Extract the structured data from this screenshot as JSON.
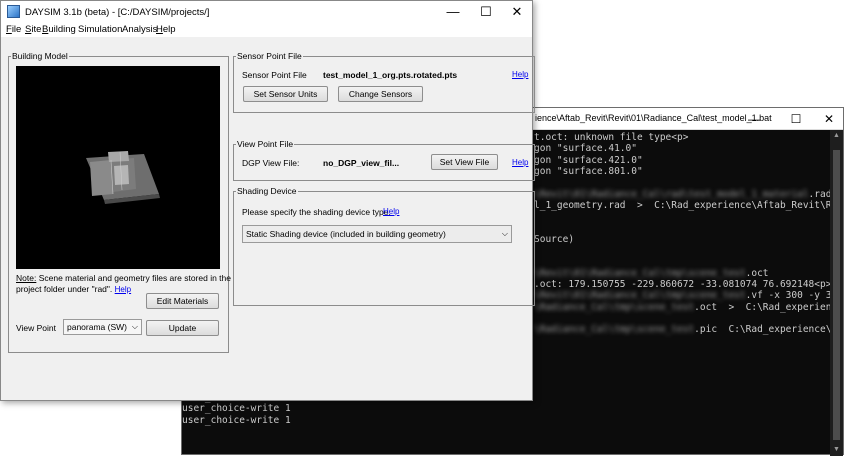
{
  "console": {
    "title": "ience\\Aftab_Revit\\Revit\\01\\Radiance_Cal\\test_model_1.bat",
    "controls": {
      "minimize": "—",
      "maximize": "☐",
      "close": "✕"
    },
    "lines": [
      {
        "text": "t.oct: unknown file type<p>",
        "blur": false
      },
      {
        "text": "gon \"surface.41.0\"",
        "blur": false
      },
      {
        "text": "gon \"surface.421.0\"",
        "blur": false
      },
      {
        "text": "gon \"surface.801.0\"",
        "blur": false
      },
      {
        "text": "",
        "blur": false
      },
      {
        "text": "\\Revit\\01\\Radiance_Cal\\rad\\test_model_1_material",
        "blur": true,
        "tail": ".rad"
      },
      {
        "text": "l_1_geometry.rad  >  C:\\Rad_experience\\Aftab_Revit\\Revit\\",
        "blur": false
      },
      {
        "text": "",
        "blur": false
      },
      {
        "text": "",
        "blur": false
      },
      {
        "text": "Source)",
        "blur": false
      },
      {
        "text": "",
        "blur": false
      },
      {
        "text": "",
        "blur": false
      },
      {
        "text": "\\Revit\\01\\Radiance_Cal\\tmp\\scene_test",
        "blur": true,
        "tail": ".oct"
      },
      {
        "text": ".oct: 179.150755 -229.860672 -33.081074 76.692148<p>",
        "blur": false
      },
      {
        "text": "\\Revit\\01\\Radiance_Cal\\tmp\\scene_test",
        "blur": true,
        "tail": ".vf -x 300 -y 300 -pj"
      },
      {
        "text": "\\Radiance_Cal\\tmp\\scene_test",
        "blur": true,
        "tail": ".oct  >  C:\\Rad_experience"
      },
      {
        "text": "",
        "blur": false
      },
      {
        "text": "\\Radiance_Cal\\tmp\\scene_test",
        "blur": true,
        "tail": ".pic  C:\\Rad_experience\\A"
      },
      {
        "text": "",
        "blur": false
      },
      {
        "text": "",
        "blur": false
      },
      {
        "text": "",
        "blur": false
      },
      {
        "text": "",
        "blur": false
      },
      {
        "text": "user_choice-write 1",
        "blur": false,
        "full": true
      },
      {
        "text": "user_choice-write 1",
        "blur": false,
        "full": true
      },
      {
        "text": "user_choice-write 1",
        "blur": false,
        "full": true
      },
      {
        "text": "user_choice-write 1",
        "blur": false,
        "full": true
      }
    ]
  },
  "daysim": {
    "title": "DAYSIM 3.1b (beta) - [C:/DAYSIM/projects/]",
    "controls": {
      "minimize": "—",
      "maximize": "☐",
      "close": "✕"
    },
    "menus": [
      {
        "label": "File",
        "underline": "F"
      },
      {
        "label": "Site",
        "underline": "S"
      },
      {
        "label": "Building",
        "underline": "B"
      },
      {
        "label": "Simulation",
        "underline": ""
      },
      {
        "label": "Analysis",
        "underline": ""
      },
      {
        "label": "Help",
        "underline": "H"
      }
    ],
    "building_model": {
      "legend": "Building Model",
      "note_label": "Note:",
      "note_text": " Scene material and geometry files are stored in the",
      "note_text2": "project folder under \"rad\".",
      "help": "Help",
      "edit_materials": "Edit Materials",
      "view_point_label": "View Point",
      "view_point_value": "panorama (SW)",
      "update": "Update"
    },
    "sensor_point_file": {
      "legend": "Sensor Point File",
      "label": "Sensor Point File",
      "value": "test_model_1_org.pts.rotated.pts",
      "help": "Help",
      "set_units": "Set Sensor Units",
      "change_sensors": "Change Sensors"
    },
    "view_point_file": {
      "legend": "View Point File",
      "label": "DGP View File:",
      "value": "no_DGP_view_fil...",
      "set_view_file": "Set View File",
      "help": "Help"
    },
    "shading_device": {
      "legend": "Shading Device",
      "prompt": "Please specify the shading device type.",
      "help": "Help",
      "selected": "Static Shading device (included in building geometry)"
    }
  },
  "colors": {
    "console_bg": "#0c0c0c",
    "console_text": "#cccccc",
    "link": "#0000ee",
    "window_bg": "#f0f0f0"
  }
}
